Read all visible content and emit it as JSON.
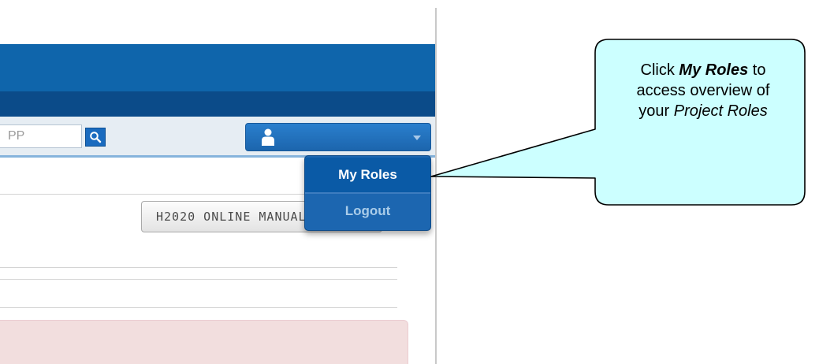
{
  "search": {
    "placeholder": "PP"
  },
  "user_menu": {
    "items": [
      {
        "label": "My Roles"
      },
      {
        "label": "Logout"
      }
    ]
  },
  "content": {
    "online_manual_button": "H2020 ONLINE MANUAL"
  },
  "callout": {
    "line1_prefix": "Click ",
    "line1_emphasis": "My Roles",
    "line1_suffix": " to",
    "line2": "access overview of",
    "line3_prefix": "your ",
    "line3_emphasis": "Project Roles"
  },
  "colors": {
    "banner": "#0f65ab",
    "nav_bar": "#0b4b89",
    "menu": "#1c66b0",
    "menu_active": "#0a5aa6",
    "callout_fill": "#ccffff",
    "alert": "#f2dede"
  }
}
